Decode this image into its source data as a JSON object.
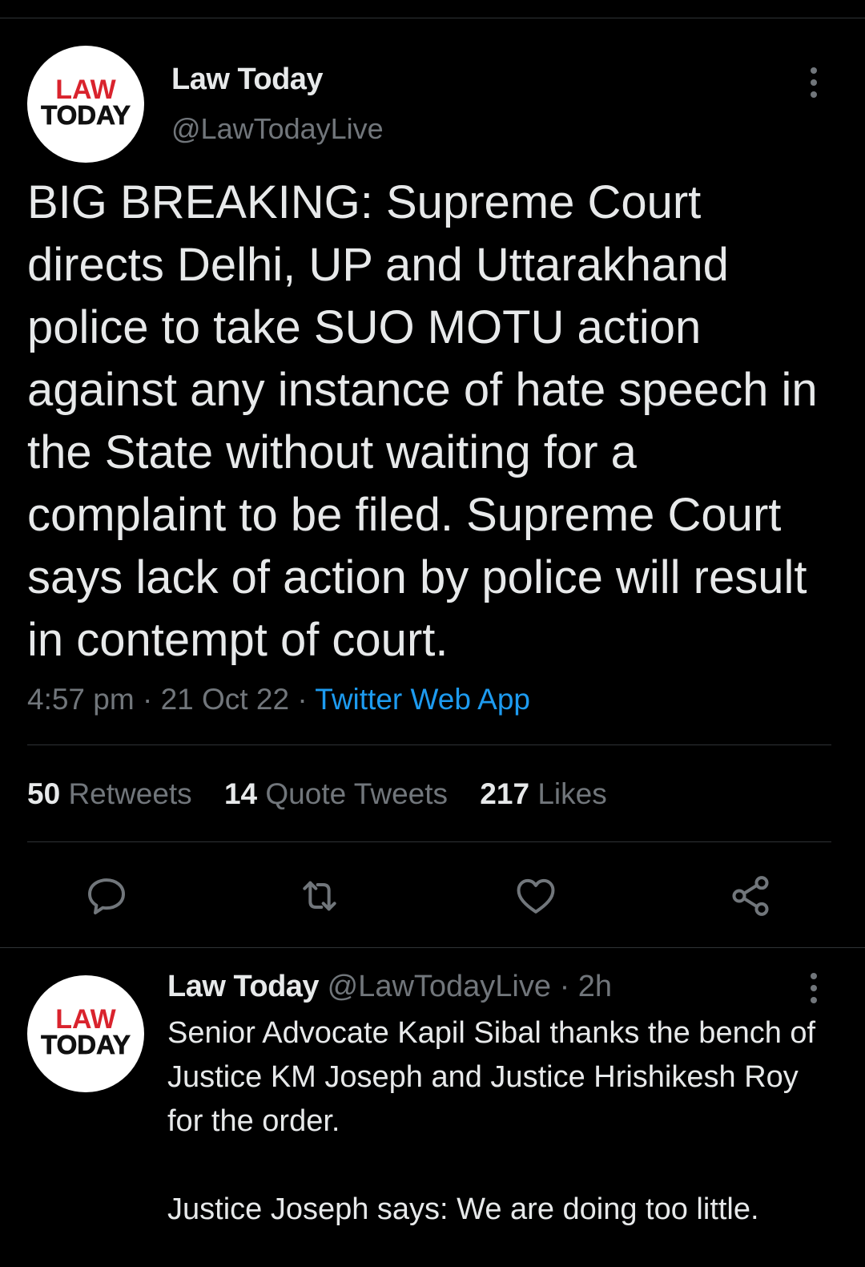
{
  "main_tweet": {
    "author_name": "Law Today",
    "author_handle": "@LawTodayLive",
    "avatar_logo": {
      "line1": "LAW",
      "line2": "TODAY"
    },
    "text": "BIG BREAKING: Supreme Court directs Delhi, UP and Uttarakhand police to take SUO MOTU action against any instance of hate speech in the State without waiting for a complaint to be filed. Supreme Court says lack of action by police will result in contempt of court.",
    "time": "4:57 pm",
    "date": "21 Oct 22",
    "separator": "·",
    "source_app": "Twitter Web App",
    "stats": {
      "retweets_count": "50",
      "retweets_label": "Retweets",
      "quotes_count": "14",
      "quotes_label": "Quote Tweets",
      "likes_count": "217",
      "likes_label": "Likes"
    },
    "actions": [
      "reply-icon",
      "retweet-icon",
      "like-icon",
      "share-icon"
    ]
  },
  "reply_tweet": {
    "author_name": "Law Today",
    "author_handle": "@LawTodayLive",
    "separator": "·",
    "time": "2h",
    "avatar_logo": {
      "line1": "LAW",
      "line2": "TODAY"
    },
    "text": "Senior Advocate Kapil Sibal thanks the bench of Justice KM Joseph and Justice Hrishikesh Roy for the order.\n\nJustice Joseph says: We are doing too little."
  },
  "colors": {
    "background": "#000000",
    "primary_text": "#e7e9ea",
    "secondary_text": "#71767b",
    "link": "#1d9bf0",
    "divider": "#2f3336",
    "logo_red": "#d9232d",
    "logo_black": "#111111"
  }
}
